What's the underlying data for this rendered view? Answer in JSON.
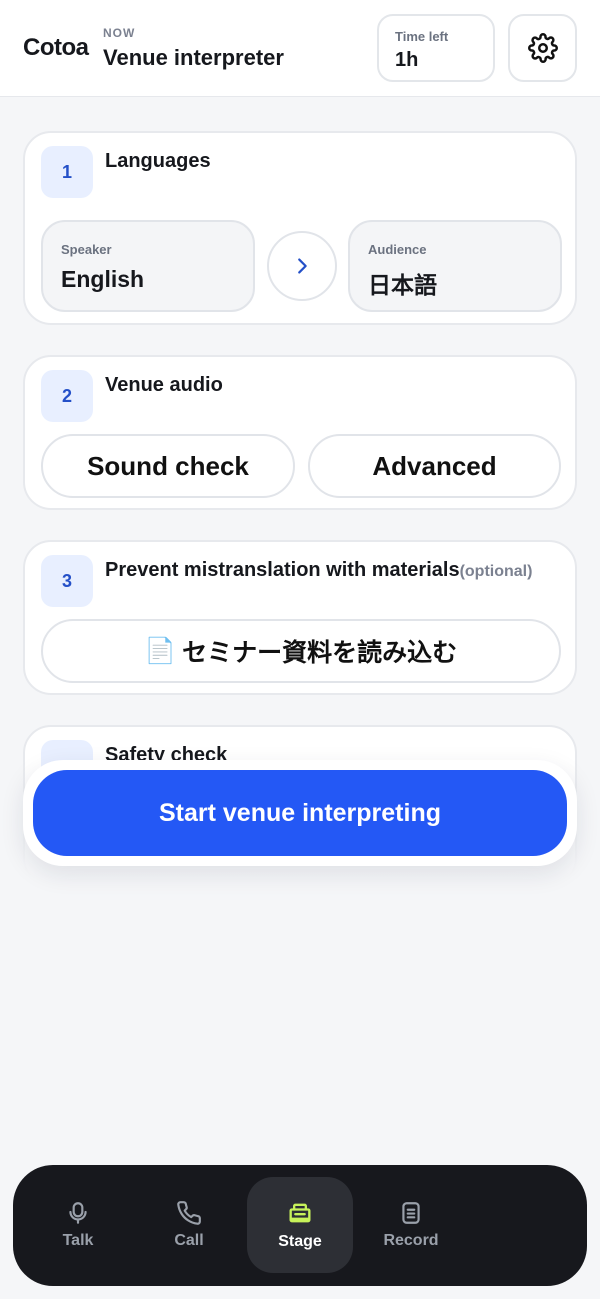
{
  "header": {
    "logo": "Cotoa",
    "now_label": "NOW",
    "mode_title": "Venue interpreter",
    "time_left_label": "Time left",
    "time_left_value": "1h",
    "settings_icon": "gear-icon"
  },
  "steps": {
    "languages": {
      "number": "1",
      "title": "Languages",
      "speaker_label": "Speaker",
      "speaker_value": "English",
      "audience_label": "Audience",
      "audience_value": "日本語",
      "swap_icon": "chevron-right-icon"
    },
    "venue_audio": {
      "number": "2",
      "title": "Venue audio",
      "sound_check_label": "Sound check",
      "advanced_label": "Advanced"
    },
    "materials": {
      "number": "3",
      "title": "Prevent mistranslation with materials",
      "optional_label": "(optional)",
      "load_icon": "📄",
      "load_label": "セミナー資料を読み込む"
    },
    "safety": {
      "title": "Safety check"
    }
  },
  "start_button": "Start venue interpreting",
  "nav": {
    "items": [
      {
        "label": "Talk",
        "icon": "microphone-icon",
        "active": false
      },
      {
        "label": "Call",
        "icon": "phone-icon",
        "active": false
      },
      {
        "label": "Stage",
        "icon": "stage-icon",
        "active": true
      },
      {
        "label": "Record",
        "icon": "document-icon",
        "active": false
      }
    ]
  },
  "colors": {
    "accent": "#2458f5",
    "badge_bg": "#e8efff",
    "badge_text": "#2450c8",
    "nav_bg": "#17181d",
    "stage_icon": "#c7f25a"
  }
}
